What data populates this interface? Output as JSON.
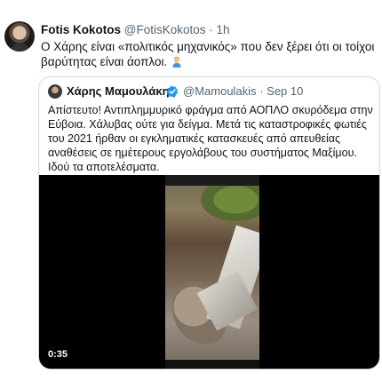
{
  "tweet": {
    "author_name": "Fotis Kokotos",
    "author_handle": "@FotisKokotos",
    "separator": "·",
    "time": "1h",
    "text": "Ο Χάρης είναι «πολιτικός μηχανικός» που δεν ξέρει ότι οι τοίχοι βαρύτητας είναι άοπλοι.",
    "emoji": "person-facepalming"
  },
  "quote": {
    "author_name": "Χάρης Μαμουλάκης",
    "verified": true,
    "author_handle": "@Mamoulakis",
    "separator": "·",
    "date": "Sep 10",
    "text": "Απίστευτο! Αντιπλημμυρικό φράγμα από ΑΟΠΛΟ σκυρόδεμα στην Εύβοια. Χάλυβας ούτε για δείγμα. Μετά τις καταστροφικές φωτιές του 2021 ήρθαν οι εγκληματικές κατασκευές από απευθείας αναθέσεις σε ημέτερους εργολάβους του συστήματος Μαξίμου. Ιδού τα αποτελέσματα.",
    "video": {
      "duration": "0:35"
    }
  },
  "colors": {
    "text_primary": "#0f1419",
    "text_muted": "#536471",
    "verified_blue": "#1d9bf0",
    "border": "#cfd9de",
    "video_bg": "#000000"
  }
}
